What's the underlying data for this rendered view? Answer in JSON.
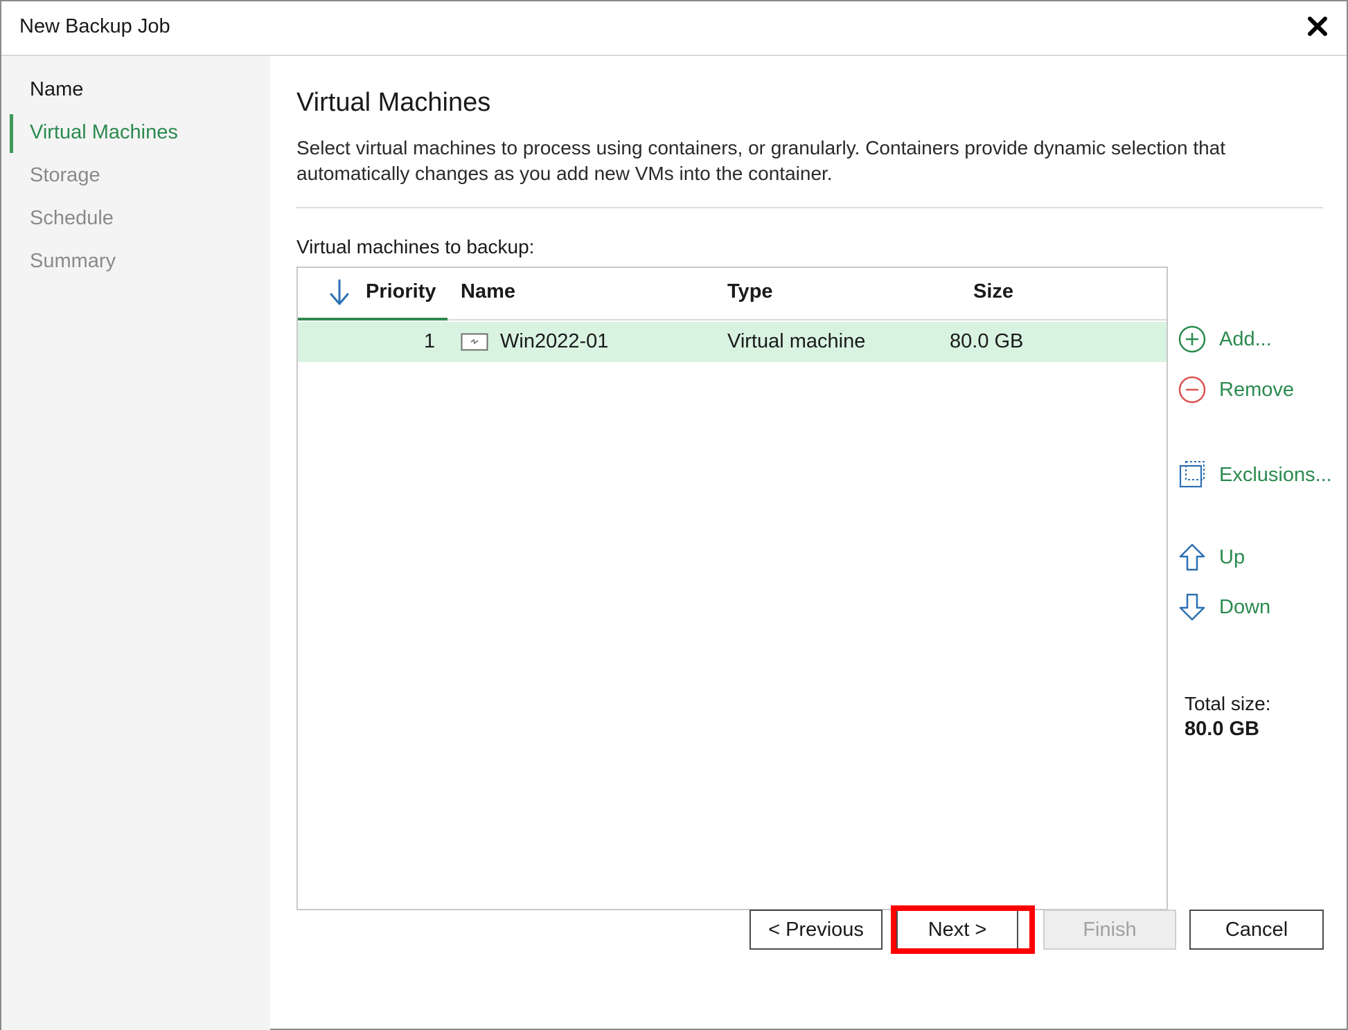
{
  "window": {
    "title": "New Backup Job",
    "close_icon": "close-icon"
  },
  "sidebar": {
    "items": [
      {
        "label": "Name",
        "state": "done"
      },
      {
        "label": "Virtual Machines",
        "state": "active"
      },
      {
        "label": "Storage",
        "state": "pending"
      },
      {
        "label": "Schedule",
        "state": "pending"
      },
      {
        "label": "Summary",
        "state": "pending"
      }
    ]
  },
  "main": {
    "heading": "Virtual Machines",
    "description": "Select virtual machines to process using containers, or granularly. Containers provide dynamic selection that automatically changes as you add new VMs into the container.",
    "list_label": "Virtual machines to backup:",
    "table": {
      "columns": [
        "Priority",
        "Name",
        "Type",
        "Size"
      ],
      "sort_icon": "sort-down-arrow-icon",
      "rows": [
        {
          "priority": "1",
          "name": "Win2022-01",
          "type": "Virtual machine",
          "size": "80.0 GB",
          "icon": "vm-icon",
          "selected": true
        }
      ]
    },
    "actions": {
      "add": "Add...",
      "remove": "Remove",
      "exclusions": "Exclusions...",
      "up": "Up",
      "down": "Down"
    },
    "total": {
      "label": "Total size:",
      "value": "80.0 GB"
    }
  },
  "footer": {
    "previous": "< Previous",
    "next": "Next >",
    "finish": "Finish",
    "cancel": "Cancel"
  },
  "colors": {
    "accent_green": "#2b8a4f",
    "selected_row": "#d9f3e1",
    "remove_red": "#d9534f",
    "arrow_blue": "#2b6fb3",
    "highlight_red": "#ff0000"
  }
}
